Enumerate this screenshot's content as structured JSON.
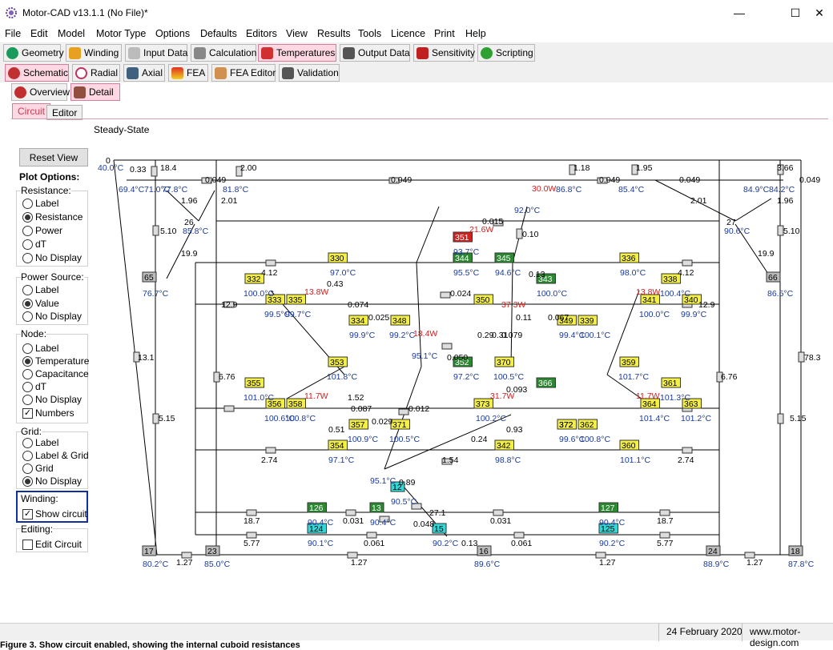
{
  "window": {
    "title": "Motor-CAD v13.1.1 (No File)*",
    "minimize": "—",
    "maximize": "☐",
    "close": "✕"
  },
  "menu": [
    "File",
    "Edit",
    "Model",
    "Motor Type",
    "Options",
    "Defaults",
    "Editors",
    "View",
    "Results",
    "Tools",
    "Licence",
    "Print",
    "Help"
  ],
  "main_tabs": [
    {
      "label": "Geometry",
      "icon": "geometry-icon",
      "color": "#1a9a5a"
    },
    {
      "label": "Winding",
      "icon": "winding-icon",
      "color": "#e0a020"
    },
    {
      "label": "Input Data",
      "icon": "input-data-icon",
      "color": "#888"
    },
    {
      "label": "Calculation",
      "icon": "calculation-icon",
      "color": "#555"
    },
    {
      "label": "Temperatures",
      "icon": "thermometer-icon",
      "color": "#d03030",
      "active": true
    },
    {
      "label": "Output Data",
      "icon": "output-data-icon",
      "color": "#444"
    },
    {
      "label": "Sensitivity",
      "icon": "sensitivity-icon",
      "color": "#c02020"
    },
    {
      "label": "Scripting",
      "icon": "scripting-icon",
      "color": "#30a030"
    }
  ],
  "sub_tabs": [
    {
      "label": "Schematic",
      "active": true
    },
    {
      "label": "Radial"
    },
    {
      "label": "Axial"
    },
    {
      "label": "FEA"
    },
    {
      "label": "FEA Editor"
    },
    {
      "label": "Validation"
    }
  ],
  "view_tabs": [
    {
      "label": "Overview"
    },
    {
      "label": "Detail",
      "active": true
    }
  ],
  "circuit_tabs": [
    {
      "label": "Circuit",
      "active": true
    },
    {
      "label": "Editor"
    }
  ],
  "mode_label": "Steady-State",
  "reset_view": "Reset View",
  "plot_options": "Plot Options:",
  "resistance": {
    "title": "Resistance:",
    "options": [
      "Label",
      "Resistance",
      "Power",
      "dT",
      "No Display"
    ],
    "selected": 1
  },
  "power_source": {
    "title": "Power Source:",
    "options": [
      "Label",
      "Value",
      "No Display"
    ],
    "selected": 1
  },
  "node": {
    "title": "Node:",
    "options": [
      "Label",
      "Temperature",
      "Capacitance",
      "dT",
      "No Display"
    ],
    "selected": 1,
    "numbers_label": "Numbers",
    "numbers_checked": true
  },
  "grid": {
    "title": "Grid:",
    "options": [
      "Label",
      "Label & Grid",
      "Grid",
      "No Display"
    ],
    "selected": 3
  },
  "winding": {
    "title": "Winding:",
    "show_circuit": "Show circuit",
    "checked": true
  },
  "editing": {
    "title": "Editing:",
    "edit_circuit": "Edit Circuit",
    "checked": false
  },
  "status": {
    "date": "24 February 2020",
    "url": "www.motor-design.com"
  },
  "caption": "Figure 3. Show circuit enabled, showing the internal cuboid resistances",
  "circuit": {
    "node_labels": [
      "0",
      "26",
      "27",
      "65",
      "66",
      "17",
      "23",
      "16",
      "24",
      "18",
      "330",
      "332",
      "333",
      "335",
      "334",
      "336",
      "338",
      "341",
      "340",
      "339",
      "349",
      "348",
      "344",
      "345",
      "343",
      "350",
      "351",
      "352",
      "366",
      "370",
      "353",
      "355",
      "356",
      "358",
      "357",
      "354",
      "371",
      "373",
      "372",
      "362",
      "361",
      "363",
      "364",
      "342",
      "359",
      "360",
      "12",
      "13",
      "15",
      "124",
      "125",
      "126",
      "127",
      "372"
    ],
    "temps": [
      "40.0°C",
      "69.4°C",
      "71.0°C",
      "77.8°C",
      "81.8°C",
      "86.8°C",
      "85.4°C",
      "84.9°C",
      "84.2°C",
      "85.8°C",
      "90.6°C",
      "76.7°C",
      "86.5°C",
      "80.2°C",
      "85.0°C",
      "89.6°C",
      "88.9°C",
      "87.8°C",
      "97.0°C",
      "100.0°C",
      "99.5°C",
      "99.7°C",
      "99.9°C",
      "99.2°C",
      "93.7°C",
      "95.5°C",
      "94.6°C",
      "100.0°C",
      "92.0°C",
      "98.0°C",
      "100.4°C",
      "100.0°C",
      "99.9°C",
      "99.4°C",
      "100.1°C",
      "95.1°C",
      "97.2°C",
      "100.5°C",
      "101.7°C",
      "101.8°C",
      "101.0°C",
      "100.6°C",
      "100.8°C",
      "100.9°C",
      "97.1°C",
      "100.5°C",
      "100.2°C",
      "99.6°C",
      "100.8°C",
      "101.3°C",
      "101.4°C",
      "101.2°C",
      "101.1°C",
      "98.8°C",
      "95.1°C",
      "90.5°C",
      "90.4°C",
      "90.4°C",
      "90.2°C",
      "90.1°C",
      "90.2°C",
      "90.4°C"
    ],
    "resistances": [
      "0.33",
      "18.4",
      "2.00",
      "1.18",
      "1.95",
      "3.66",
      "0.049",
      "0.049",
      "0.049",
      "0.049",
      "0.049",
      "1.96",
      "2.01",
      "2.01",
      "1.96",
      "5.10",
      "5.10",
      "19.9",
      "19.9",
      "13.1",
      "78.3",
      "6.76",
      "6.76",
      "5.15",
      "5.15",
      "1.27",
      "1.27",
      "1.27",
      "1.27",
      "4.12",
      "4.12",
      "12.9",
      "12.9",
      "2.74",
      "2.74",
      "18.7",
      "18.7",
      "5.77",
      "5.77",
      "0.031",
      "0.031",
      "0.061",
      "0.061",
      "27.1",
      "0.048",
      "0.13",
      "0.89",
      "1.54",
      "0.012",
      "0.024",
      "0.015",
      "0.10",
      "0.13",
      "0.43",
      "0.074",
      "0.025",
      "0.11",
      "0.067",
      "0.079",
      "0.050",
      "0.093",
      "0.087",
      "0.029",
      "0.24",
      "1.52",
      "0.51",
      "0.31",
      "0.29",
      "0.93"
    ],
    "powers": [
      "30.0W",
      "21.6W",
      "18.4W",
      "13.8W",
      "37.3W",
      "13.8W",
      "11.7W",
      "31.7W",
      "11.7W"
    ]
  }
}
